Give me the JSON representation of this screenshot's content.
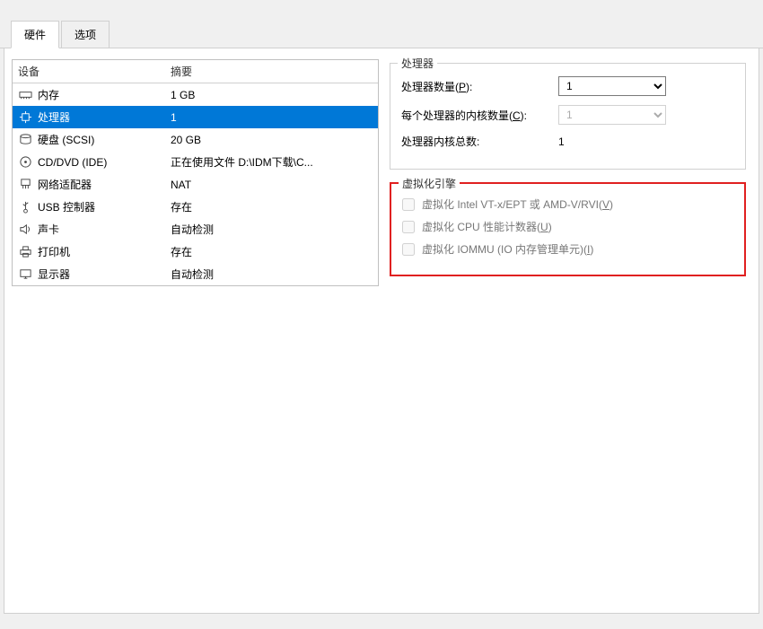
{
  "tabs": {
    "hardware": "硬件",
    "options": "选项"
  },
  "devtable": {
    "header_device": "设备",
    "header_summary": "摘要",
    "rows": [
      {
        "name": "内存",
        "summary": "1 GB"
      },
      {
        "name": "处理器",
        "summary": "1"
      },
      {
        "name": "硬盘 (SCSI)",
        "summary": "20 GB"
      },
      {
        "name": "CD/DVD (IDE)",
        "summary": "正在使用文件 D:\\IDM下载\\C..."
      },
      {
        "name": "网络适配器",
        "summary": "NAT"
      },
      {
        "name": "USB 控制器",
        "summary": "存在"
      },
      {
        "name": "声卡",
        "summary": "自动检测"
      },
      {
        "name": "打印机",
        "summary": "存在"
      },
      {
        "name": "显示器",
        "summary": "自动检测"
      }
    ]
  },
  "processor": {
    "group_title": "处理器",
    "count_label_pre": "处理器数量(",
    "count_label_key": "P",
    "count_label_post": "):",
    "count_value": "1",
    "cores_label_pre": "每个处理器的内核数量(",
    "cores_label_key": "C",
    "cores_label_post": "):",
    "cores_value": "1",
    "total_label": "处理器内核总数:",
    "total_value": "1"
  },
  "virtualization": {
    "group_title": "虚拟化引擎",
    "vt_pre": "虚拟化 Intel VT-x/EPT 或 AMD-V/RVI(",
    "vt_key": "V",
    "vt_post": ")",
    "perf_pre": "虚拟化 CPU 性能计数器(",
    "perf_key": "U",
    "perf_post": ")",
    "iommu_pre": "虚拟化 IOMMU (IO 内存管理单元)(",
    "iommu_key": "I",
    "iommu_post": ")"
  }
}
